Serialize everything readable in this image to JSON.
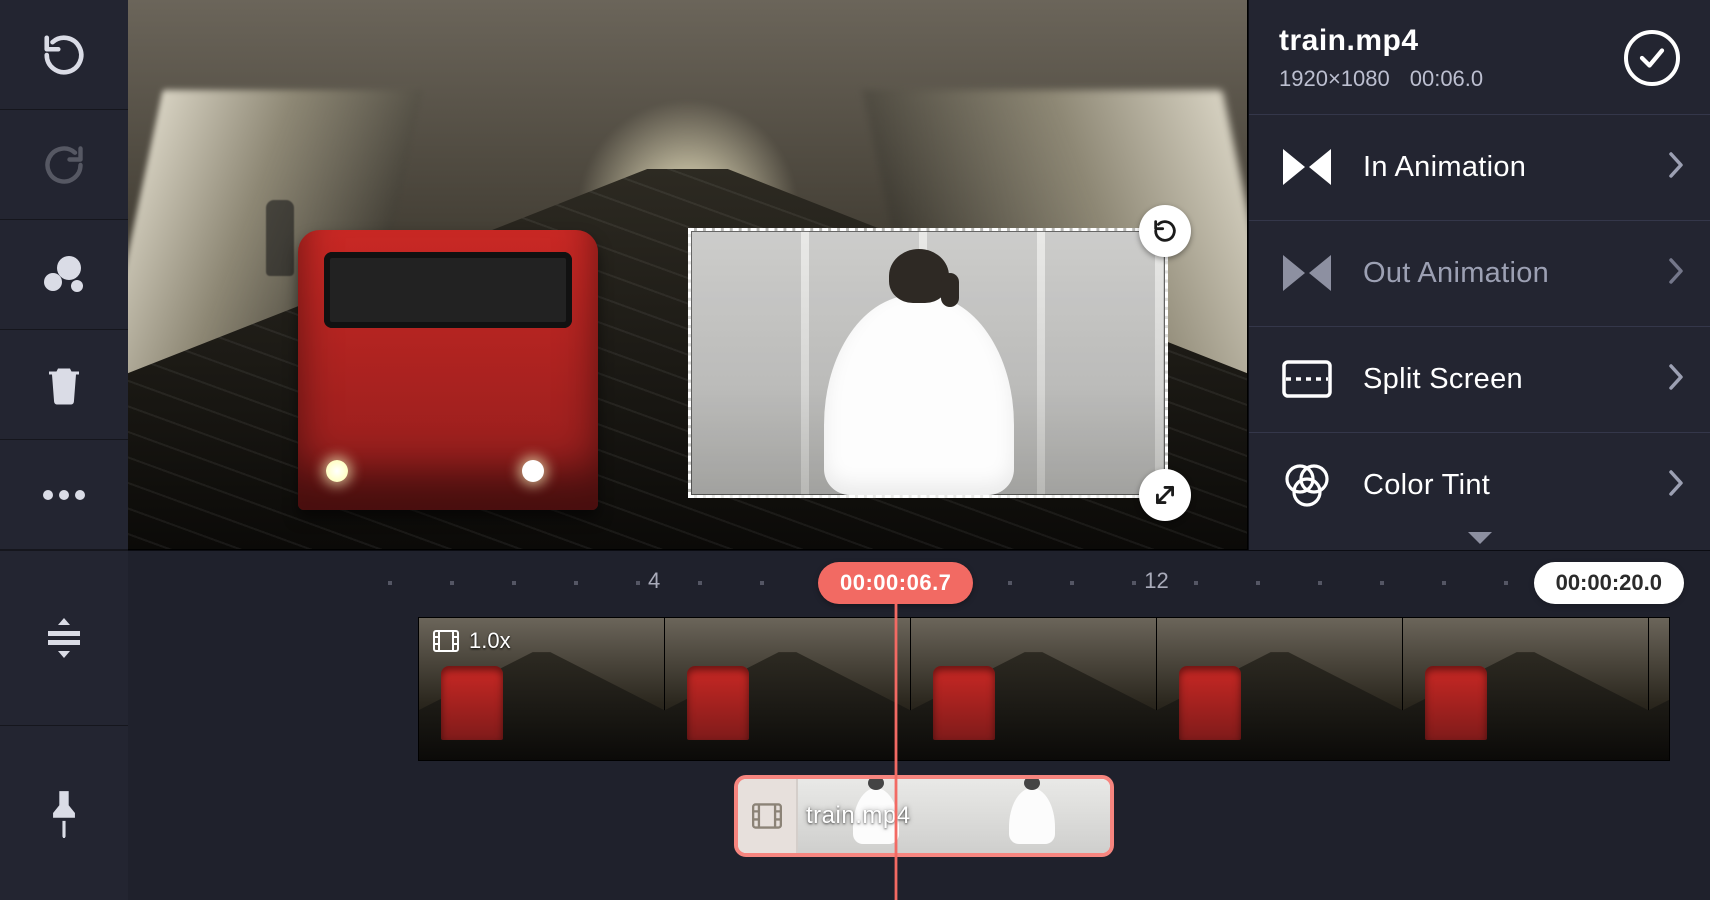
{
  "clip": {
    "name": "train.mp4",
    "resolution": "1920×1080",
    "duration": "00:06.0"
  },
  "menu": {
    "in_animation": "In Animation",
    "out_animation": "Out Animation",
    "split_screen": "Split Screen",
    "color_tint": "Color Tint"
  },
  "timeline": {
    "ruler_marks": [
      "4",
      "12"
    ],
    "playhead_time": "00:00:06.7",
    "total_duration": "00:00:20.0",
    "main_track": {
      "speed_label": "1.0x"
    },
    "secondary_clip": {
      "label": "train.mp4"
    }
  },
  "left_tools": {
    "undo": "undo",
    "redo": "redo",
    "shapes": "shapes",
    "delete": "delete",
    "more": "more",
    "expand_tracks": "expand-tracks",
    "pin": "pin"
  }
}
